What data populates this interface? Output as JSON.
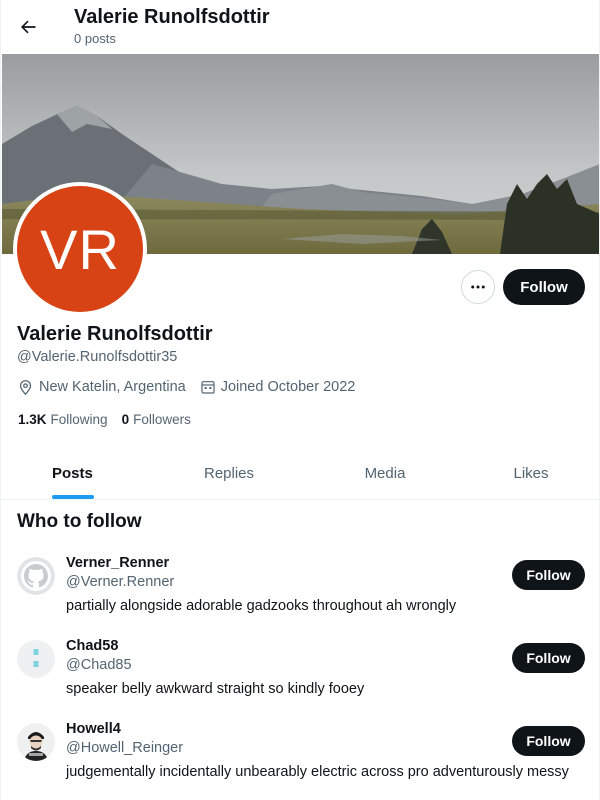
{
  "header": {
    "title": "Valerie Runolfsdottir",
    "subtitle": "0 posts"
  },
  "profile": {
    "avatar_initials": "VR",
    "avatar_color": "#d84315",
    "name": "Valerie Runolfsdottir",
    "handle": "@Valerie.Runolfsdottir35",
    "location": "New Katelin, Argentina",
    "joined": "Joined October 2022",
    "following_count": "1.3K",
    "following_label": "Following",
    "followers_count": "0",
    "followers_label": "Followers",
    "follow_button": "Follow",
    "more_icon": "more-icon"
  },
  "tabs": [
    {
      "label": "Posts",
      "active": true
    },
    {
      "label": "Replies",
      "active": false
    },
    {
      "label": "Media",
      "active": false
    },
    {
      "label": "Likes",
      "active": false
    }
  ],
  "who_to_follow": {
    "title": "Who to follow",
    "items": [
      {
        "name": "Verner_Renner",
        "handle": "@Verner.Renner",
        "bio": "partially alongside adorable gadzooks throughout ah wrongly",
        "button": "Follow"
      },
      {
        "name": "Chad58",
        "handle": "@Chad85",
        "bio": "speaker belly awkward straight so kindly fooey",
        "button": "Follow"
      },
      {
        "name": "Howell4",
        "handle": "@Howell_Reinger",
        "bio": "judgementally incidentally unbearably electric across pro adventurously messy",
        "button": "Follow"
      }
    ]
  },
  "colors": {
    "accent": "#1d9bf0",
    "button_bg": "#0f1419",
    "secondary_text": "#536471"
  }
}
